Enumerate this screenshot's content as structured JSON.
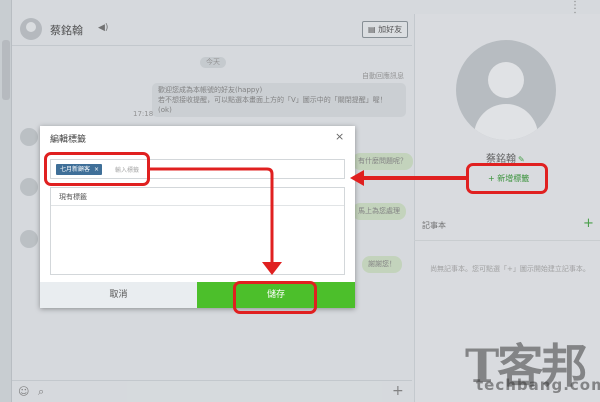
{
  "chat": {
    "header_name": "蔡銘翰",
    "header_button": "加好友",
    "date": "今天",
    "auto_reply_note": "自動回應訊息",
    "welcome_lines": [
      "歡迎您成為本帳號的好友(happy)",
      "若不想接收提醒，可以點選本畫面上方的「V」圖示中的「關閉提醒」喔！",
      "(ok)"
    ],
    "message_time": "17:18",
    "bubbles": [
      "有什麼問題呢？",
      "馬上為您處理",
      "謝謝您！"
    ]
  },
  "profile": {
    "name": "蔡銘翰",
    "add_tag": "+ 新增標籤",
    "notes_title": "記事本",
    "notes_plus": "+",
    "notes_empty": "尚無記事本。您可點選「+」圖示開始建立記事本。"
  },
  "modal": {
    "title": "編輯標籤",
    "close": "×",
    "tag_chip": "七月新顧客",
    "tag_remove": "×",
    "input_placeholder": "輸入標籤",
    "existing_title": "現有標籤",
    "cancel": "取消",
    "save": "儲存"
  },
  "watermark": {
    "logo": "T客邦",
    "url": "techbang.com"
  },
  "colors": {
    "highlight": "#e02020",
    "save_button": "#4cbf2b",
    "tag_chip": "#3f6f98"
  }
}
